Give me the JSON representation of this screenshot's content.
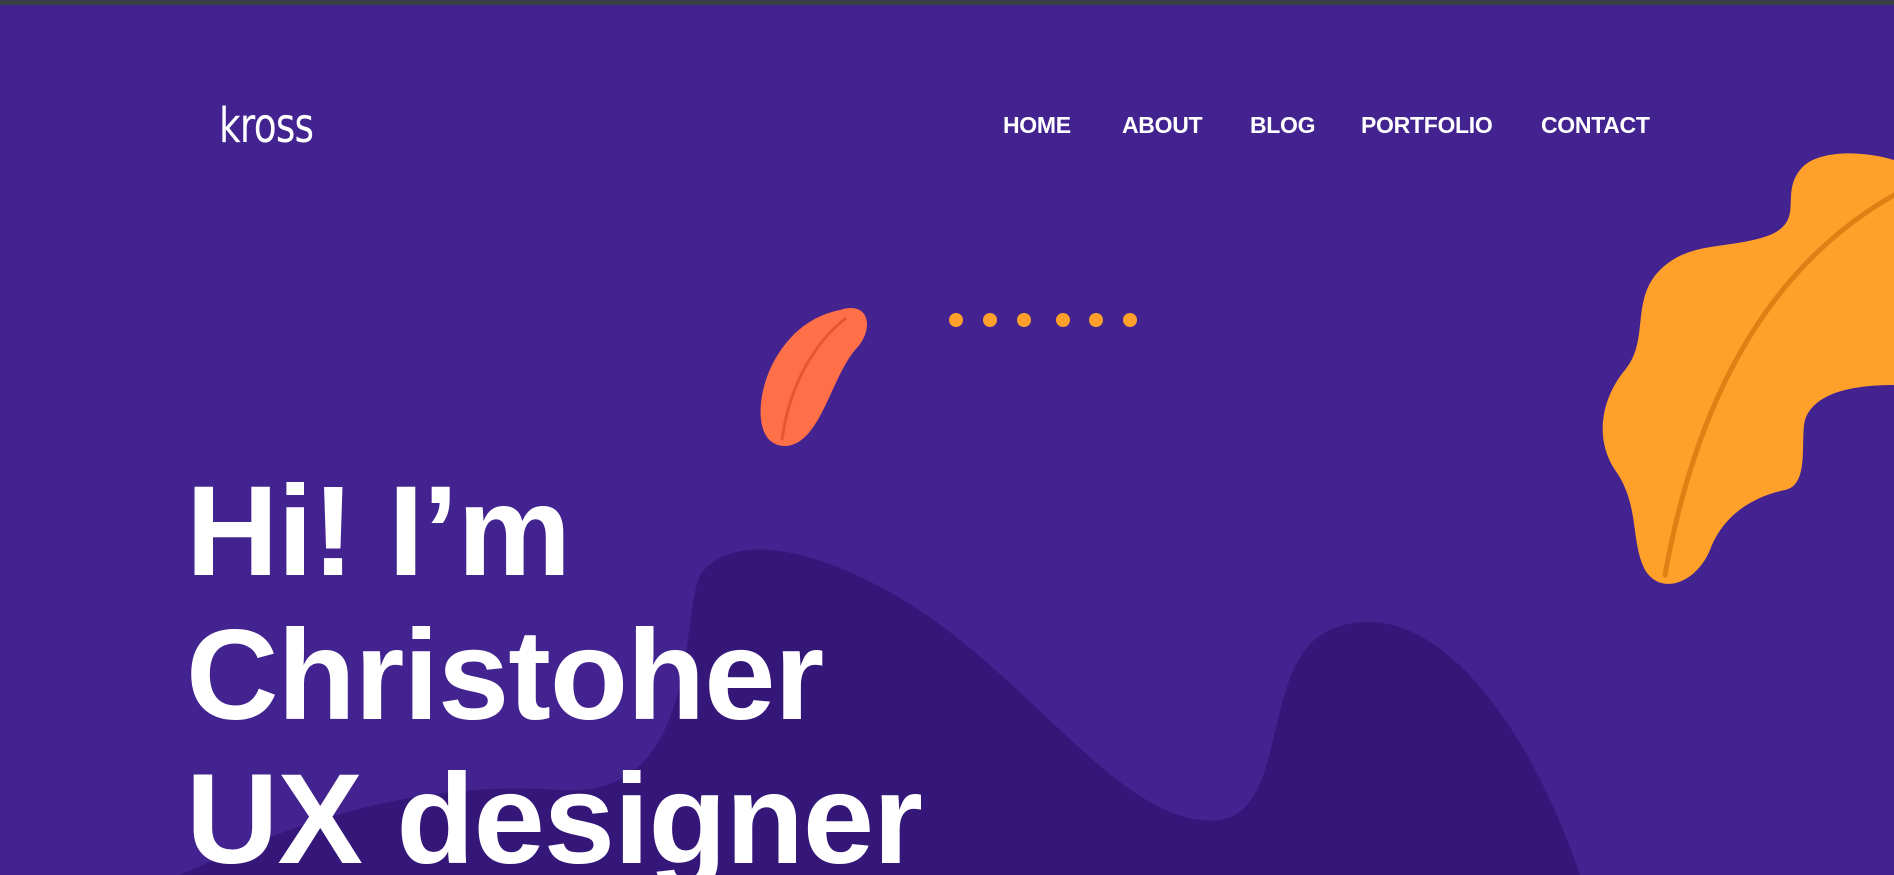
{
  "brand": {
    "logo_text": "kross"
  },
  "nav": {
    "items": [
      {
        "label": "HOME"
      },
      {
        "label": "ABOUT"
      },
      {
        "label": "BLOG"
      },
      {
        "label": "PORTFOLIO"
      },
      {
        "label": "CONTACT"
      }
    ]
  },
  "hero": {
    "line1": "Hi! I’m",
    "line2": "Christoher",
    "line3": "UX designer"
  },
  "colors": {
    "background": "#42238f",
    "blob": "#35177a",
    "leaf_large": "#ffa02b",
    "leaf_large_vein": "#e07f14",
    "leaf_small": "#ff6f48",
    "dots": "#ffa02b",
    "text": "#ffffff"
  }
}
